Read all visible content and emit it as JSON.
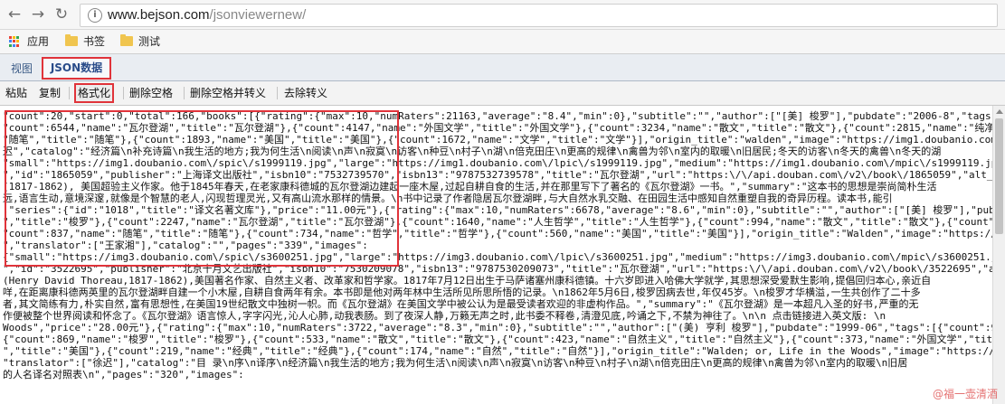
{
  "browser": {
    "url_domain": "www.bejson.com",
    "url_path": "/jsonviewernew/",
    "bookmarks": [
      {
        "label": "应用",
        "type": "apps"
      },
      {
        "label": "书签",
        "type": "folder"
      },
      {
        "label": "测试",
        "type": "folder"
      }
    ]
  },
  "tabs": {
    "view": "视图",
    "json": "JSON数据"
  },
  "toolbar": {
    "paste": "粘贴",
    "copy": "复制",
    "format": "格式化",
    "remove_space": "删除空格",
    "remove_space_escape": "删除空格并转义",
    "unescape": "去除转义"
  },
  "editor": {
    "lines": [
      "\"count\":20,\"start\":0,\"total\":166,\"books\":[{\"rating\":{\"max\":10,\"numRaters\":21163,\"average\":\"8.4\",\"min\":0},\"subtitle\":\"\",\"author\":[\"[美] 梭罗\"],\"pubdate\":\"2006-8\",\"tags\":[{\"count\":6775,",
      "\"count\":6544,\"name\":\"瓦尔登湖\",\"title\":\"瓦尔登湖\"},{\"count\":4147,\"name\":\"外国文学\",\"title\":\"外国文学\"},{\"count\":3234,\"name\":\"散文\",\"title\":\"散文\"},{\"count\":2815,\"name\":\"纯净\",\"title\":",
      "\"随笔\",\"title\":\"随笔\"},{\"count\":1893,\"name\":\"美国\",\"title\":\"美国\"},{\"count\":1672,\"name\":\"文学\",\"title\":\"文学\"}],\"origin_title\":\"walden\",\"image\":\"https://img1.doubanio.com/mpic\\/s1999119.jp",
      "迟\",\"catalog\":\"经济篇\\n补充诗篇\\n我生活的地方;我为何生活\\n阅读\\n声\\n寂寞\\n访客\\n种豆\\n村子\\n湖\\n倍克田庄\\n更高的规律\\n禽兽为邻\\n室内的取暖\\n旧居民;冬天的访客\\n冬天的禽兽\\n冬天的湖",
      "\"small\":\"https://img1.doubanio.com\\/spic\\/s1999119.jpg\",\"large\":\"https://img1.doubanio.com\\/lpic\\/s1999119.jpg\",\"medium\":\"https://img1.doubanio.com\\/mpic\\/s1999119.jpg\"},\"alt\":\"https:",
      "\",\"id\":\"1865059\",\"publisher\":\"上海译文出版社\",\"isbn10\":\"7532739570\",\"isbn13\":\"9787532739578\",\"title\":\"瓦尔登湖\",\"url\":\"https:\\/\\/api.douban.com\\/v2\\/book\\/1865059\",\"alt_title\":\"walden\",",
      "(1817-1862), 美国超验主义作家。他于1845年春天,在老家康科德城的瓦尔登湖边建起一座木屋,过起自耕自食的生活,并在那里写下了著名的《瓦尔登湖》一书。\",\"summary\":\"这本书的思想是崇尚简朴生活",
      "远,语言生动,意境深邃,就像是个智慧的老人,闪现哲理灵光,又有高山流水那样的情景。\\n书中记录了作者隐居瓦尔登湖畔,与大自然水乳交融、在田园生活中感知自然重塑自我的奇异历程。读本书,能引",
      ",\"series\":{\"id\":\"1018\",\"title\":\"译文名著文库\"},\"price\":\"11.00元\"},{\"rating\":{\"max\":10,\"numRaters\":6678,\"average\":\"8.6\",\"min\":0},\"subtitle\":\"\",\"author\":[\"[美] 梭罗\"],\"pubdate\":\"2009",
      "\",\"title\":\"梭罗\"},{\"count\":2247,\"name\":\"瓦尔登湖\",\"title\":\"瓦尔登湖\"},{\"count\":1640,\"name\":\"人生哲学\",\"title\":\"人生哲学\"},{\"count\":994,\"name\":\"散文\",\"title\":\"散文\"},{\"count\":960,\"name\":",
      "\"count\":837,\"name\":\"随笔\",\"title\":\"随笔\"},{\"count\":734,\"name\":\"哲学\",\"title\":\"哲学\"},{\"count\":560,\"name\":\"美国\",\"title\":\"美国\"}],\"origin_title\":\"Walden\",\"image\":\"https://img3.doubanio.com",
      "\",\"translator\":[\"王家湘\"],\"catalog\":\"\",\"pages\":\"339\",\"images\":",
      "{\"small\":\"https://img3.doubanio.com\\/spic\\/s3600251.jpg\",\"large\":\"https://img3.doubanio.com\\/lpic\\/s3600251.jpg\",\"medium\":\"https://img3.doubanio.com\\/mpic\\/s3600251.jpg\"},\"alt\":\"https://",
      "\",\"id\":\"3522695\",\"publisher\":\"北京十月文艺出版社\",\"isbn10\":\"7530209078\",\"isbn13\":\"9787530209073\",\"title\":\"瓦尔登湖\",\"url\":\"https:\\/\\/api.douban.com\\/v2\\/book\\/3522695\",\"alt_title\":\"Walden\",",
      "(Henry David Thoreau,1817-1862),美国著名作家、自然主义者、改革家和哲学家。1817年7月12日出生于马萨诸塞州康科德镇。十六岁即进入哈佛大学就学,其思想深受爱默生影响,提倡回归本心,亲近自",
      "咩,在距离康科德两英里的瓦尔登湖畔自建一个小木屋,自耕自食两年有余。本书即是他对两年林中生活所见所思所悟的记录。\\n1862年5月6日,梭罗因病去世,年仅45岁。\\n梭罗才华横溢,一生共创作了二十多",
      "者,其文简练有力,朴实自然,富有思想性,在美国19世纪散文中独树一帜。而《瓦尔登湖》在美国文学中被公认为是最受读者欢迎的非虚构作品。\",\"summary\":\"《瓦尔登湖》是一本超凡入圣的好书,严重的无",
      "作便被整个世界阅读和怀念了。《瓦尔登湖》语言惊人,字字闪光,沁人心肺,动我表肠。到了夜深人静,万籁无声之时,此书委不释卷,清澄见底,吟诵之下,不禁为神往了。\\n\\n 点击链接进入英文版: \\n",
      "Woods\",\"price\":\"28.00元\"},{\"rating\":{\"max\":10,\"numRaters\":3722,\"average\":\"8.3\",\"min\":0},\"subtitle\":\"\",\"author\":[\"(美) 亨利 梭罗\"],\"pubdate\":\"1999-06\",\"tags\":[{\"count\":953,\"name\":\"瓦尔",
      "{\"count\":869,\"name\":\"梭罗\",\"title\":\"梭罗\"},{\"count\":533,\"name\":\"散文\",\"title\":\"散文\"},{\"count\":423,\"name\":\"自然主义\",\"title\":\"自然主义\"},{\"count\":373,\"name\":\"外国文学\",\"title\":\"外国文学",
      "\",\"title\":\"美国\"},{\"count\":219,\"name\":\"经典\",\"title\":\"经典\"},{\"count\":174,\"name\":\"自然\",\"title\":\"自然\"}],\"origin_title\":\"Walden; or, Life in the Woods\",\"image\":\"https://img3.doubanio.",
      "\"translator\":[\"徐迟\"],\"catalog\":\"目 录\\n序\\n译序\\n经济篇\\n我生活的地方;我为何生活\\n阅读\\n声\\n寂寞\\n访客\\n种豆\\n村子\\n湖\\n倍克田庄\\n更高的规律\\n禽兽为邻\\n室内的取暖\\n旧居",
      "的人名译名对照表\\n\",\"pages\":\"320\",\"images\":",
      "                                                                                    "
    ]
  },
  "watermark": "@福一壶清酒"
}
